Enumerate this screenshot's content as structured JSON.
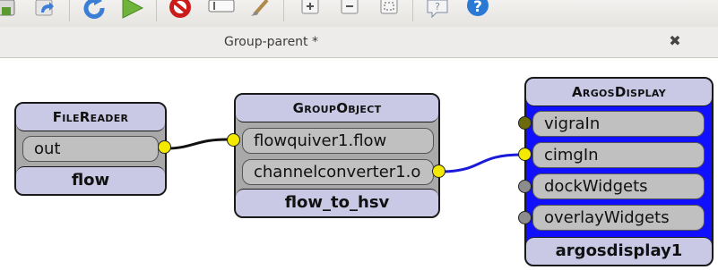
{
  "toolbar": {
    "buttons": [
      {
        "name": "save-icon",
        "color": "#5a9a2e"
      },
      {
        "name": "redo-icon",
        "color": "#3a7fd5"
      },
      {
        "name": "refresh-icon",
        "color": "#3a7fd5"
      },
      {
        "name": "run-icon",
        "color": "#6fb33a"
      },
      {
        "name": "stop-icon",
        "color": "#cc1b1b"
      },
      {
        "name": "text-field-icon",
        "color": "#666666"
      },
      {
        "name": "brush-icon",
        "color": "#b08a4a"
      },
      {
        "name": "zoom-in-icon",
        "color": "#555555"
      },
      {
        "name": "zoom-out-icon",
        "color": "#555555"
      },
      {
        "name": "fit-icon",
        "color": "#555555"
      },
      {
        "name": "whats-this-icon",
        "color": "#7a8aa3"
      },
      {
        "name": "help-icon",
        "color": "#2a7ad5"
      }
    ]
  },
  "tab": {
    "title": "Group-parent *",
    "close_glyph": "✖"
  },
  "nodes": {
    "filereader": {
      "title": "FileReader",
      "ports": [
        "out"
      ],
      "instance": "flow"
    },
    "groupobject": {
      "title": "GroupObject",
      "ports": [
        "flowquiver1.flow",
        "channelconverter1.o"
      ],
      "instance": "flow_to_hsv"
    },
    "argosdisplay": {
      "title": "ArgosDisplay",
      "ports": [
        "vigraIn",
        "cimgIn",
        "dockWidgets",
        "overlayWidgets"
      ],
      "instance": "argosdisplay1"
    }
  },
  "colors": {
    "connected_dot": "#f4e900",
    "olive_dot": "#6b6b0d",
    "idle_dot": "#8c8c8c",
    "argos_body": "#1010ff",
    "header_fill": "#c9c9e6",
    "wire_black": "#111111",
    "wire_blue": "#1a1ad8"
  }
}
